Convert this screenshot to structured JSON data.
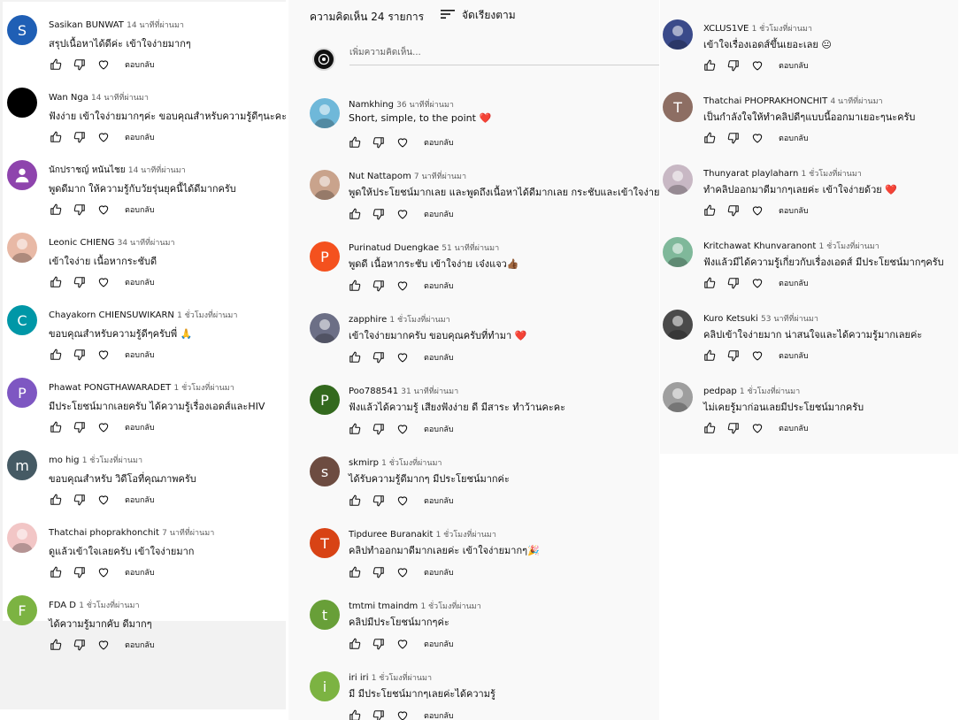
{
  "ui": {
    "reply_label": "ตอบกลับ"
  },
  "header": {
    "count_label": "ความคิดเห็น 24 รายการ",
    "sort_label": "จัดเรียงตาม",
    "add_placeholder": "เพิ่มความคิดเห็น..."
  },
  "col1": [
    {
      "author": "Sasikan BUNWAT",
      "time": "14 นาทีที่ผ่านมา",
      "text": "สรุปเนื้อหาได้ดีค่ะ เข้าใจง่ายมากๆ",
      "avatar": "S",
      "color": "#1f5fb5"
    },
    {
      "author": "Wan Nga",
      "time": "14 นาทีที่ผ่านมา",
      "text": "ฟังง่าย เข้าใจง่ายมากๆค่ะ ขอบคุณสำหรับความรู้ดีๆนะคะ",
      "avatar": "",
      "color": "#000000"
    },
    {
      "author": "นักปราชญ์ หนันไชย",
      "time": "14 นาทีที่ผ่านมา",
      "text": "พูดดีมาก ให้ความรู้กับวัยรุ่นยุคนี้ได้ดีมากครับ",
      "avatar": "person",
      "color": "#8e44ad"
    },
    {
      "author": "Leonic CHIENG",
      "time": "34 นาทีที่ผ่านมา",
      "text": "เข้าใจง่าย เนื้อหากระชับดี",
      "avatar": "photo",
      "color": "#e8b9a6"
    },
    {
      "author": "Chayakorn CHIENSUWIKARN",
      "time": "1 ชั่วโมงที่ผ่านมา",
      "text": "ขอบคุณสำหรับความรู้ดีๆครับพี่ 🙏",
      "avatar": "C",
      "color": "#0097a7"
    },
    {
      "author": "Phawat PONGTHAWARADET",
      "time": "1 ชั่วโมงที่ผ่านมา",
      "text": "มีประโยชน์มากเลยครับ ได้ความรู้เรื่องเอดส์และHIV",
      "avatar": "P",
      "color": "#7e57c2"
    },
    {
      "author": "mo hig",
      "time": "1 ชั่วโมงที่ผ่านมา",
      "text": "ขอบคุณสำหรับ วิดีโอที่คุณภาพครับ",
      "avatar": "m",
      "color": "#455a64"
    },
    {
      "author": "Thatchai phoprakhonchit",
      "time": "7 นาทีที่ผ่านมา",
      "text": "ดูแล้วเข้าใจเลยครับ เข้าใจง่ายมาก",
      "avatar": "photo",
      "color": "#f2c6c6"
    },
    {
      "author": "FDA D",
      "time": "1 ชั่วโมงที่ผ่านมา",
      "text": "ได้ความรู้มากคับ ดีมากๆ",
      "avatar": "F",
      "color": "#7cb342"
    }
  ],
  "col2": [
    {
      "author": "Namkhing",
      "time": "36 นาทีที่ผ่านมา",
      "text": "Short, simple, to the point ❤️",
      "avatar": "photo",
      "color": "#6fb8d9"
    },
    {
      "author": "Nut Nattapom",
      "time": "7 นาทีที่ผ่านมา",
      "text": "พูดให้ประโยชน์มากเลย และพูดถึงเนื้อหาได้ดีมากเลย กระชับและเข้าใจง่าย",
      "avatar": "photo",
      "color": "#c9a38c"
    },
    {
      "author": "Purinatud Duengkae",
      "time": "51 นาทีที่ผ่านมา",
      "text": "พูดดี เนื้อหากระชับ เข้าใจง่าย เจ๋งแจว👍🏾",
      "avatar": "P",
      "color": "#f4511e"
    },
    {
      "author": "zapphire",
      "time": "1 ชั่วโมงที่ผ่านมา",
      "text": "เข้าใจง่ายมากครับ ขอบคุณครับที่ทำมา ❤️",
      "avatar": "photo",
      "color": "#6c6f86"
    },
    {
      "author": "Poo788541",
      "time": "31 นาทีที่ผ่านมา",
      "text": "ฟังแล้วได้ความรู้ เสียงฟังง่าย ดี มีสาระ ทำว้านคะคะ",
      "avatar": "P",
      "color": "#33691e"
    },
    {
      "author": "skmirp",
      "time": "1 ชั่วโมงที่ผ่านมา",
      "text": "ได้รับความรู้ดีมากๆ มีประโยชน์มากค่ะ",
      "avatar": "s",
      "color": "#6d4c41"
    },
    {
      "author": "Tipduree Buranakit",
      "time": "1 ชั่วโมงที่ผ่านมา",
      "text": "คลิปทำออกมาดีมากเลยค่ะ เข้าใจง่ายมากๆ🎉",
      "avatar": "T",
      "color": "#d84315"
    },
    {
      "author": "tmtmi tmaindm",
      "time": "1 ชั่วโมงที่ผ่านมา",
      "text": "คลิปมีประโยชน์มากๆค่ะ",
      "avatar": "t",
      "color": "#689f38"
    },
    {
      "author": "iri iri",
      "time": "1 ชั่วโมงที่ผ่านมา",
      "text": "มี มีประโยชน์มากๆเลยค่ะได้ความรู้",
      "avatar": "i",
      "color": "#7cb342"
    }
  ],
  "col3": [
    {
      "author": "XCLUS1VE",
      "time": "1 ชั่วโมงที่ผ่านมา",
      "text": "เข้าใจเรื่องเอดส์ขึ้นเยอะเลย 😐",
      "avatar": "photo",
      "color": "#3a4a8a"
    },
    {
      "author": "Thatchai PHOPRAKHONCHIT",
      "time": "4 นาทีที่ผ่านมา",
      "text": "เป็นกำลังใจให้ทำคลิปดีๆแบบนี้ออกมาเยอะๆนะครับ",
      "avatar": "T",
      "color": "#8d6e63"
    },
    {
      "author": "Thunyarat playlaharn",
      "time": "1 ชั่วโมงที่ผ่านมา",
      "text": "ทำคลิปออกมาดีมากๆเลยค่ะ เข้าใจง่ายด้วย ❤️",
      "avatar": "photo",
      "color": "#c8b8c4"
    },
    {
      "author": "Kritchawat Khunvaranont",
      "time": "1 ชั่วโมงที่ผ่านมา",
      "text": "ฟังแล้วมีได้ความรู้เกี่ยวกับเรื่องเอดส์ มีประโยชน์มากๆครับ",
      "avatar": "photo",
      "color": "#7fb89a"
    },
    {
      "author": "Kuro Ketsuki",
      "time": "53 นาทีที่ผ่านมา",
      "text": "คลิปเข้าใจง่ายมาก น่าสนใจและได้ความรู้มากเลยค่ะ",
      "avatar": "photo",
      "color": "#4a4a4a"
    },
    {
      "author": "pedpap",
      "time": "1 ชั่วโมงที่ผ่านมา",
      "text": "ไม่เคยรู้มาก่อนเลยมีประโยชน์มากครับ",
      "avatar": "photo",
      "color": "#9e9e9e"
    }
  ]
}
